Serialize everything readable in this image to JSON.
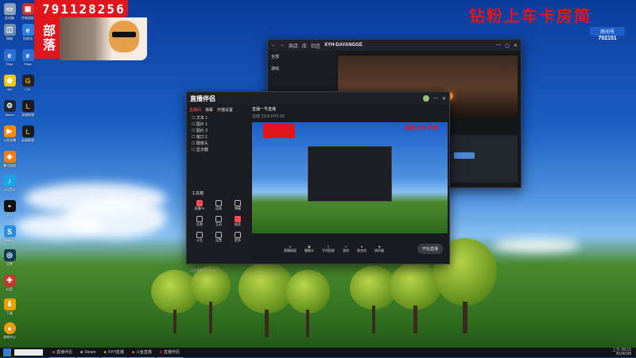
{
  "overlay": {
    "room_id": "791128256",
    "clan_label": "部落",
    "banner_text": "钻粉上车卡房简",
    "room_number_label": "房间号",
    "room_number": "702151",
    "brand_color": "#e0161c"
  },
  "desktop_icons": [
    "此电脑",
    "网络",
    "回收站",
    "控制面板",
    "Edge",
    "QQ",
    "360",
    "LOL",
    "Steam",
    "英雄联盟",
    "斗鱼直播",
    "腾讯游戏",
    "QQ音乐",
    "网易云",
    "抖音",
    "游戏中心",
    "设置",
    "下载"
  ],
  "browser": {
    "title": "XYH-DAYANGGE",
    "nav_items": [
      "商店",
      "库",
      "社区"
    ],
    "side_labels": [
      "全部",
      "游戏"
    ],
    "accent": "#4a88d8"
  },
  "obs": {
    "logo": "直播伴侣",
    "tabs": [
      "直播间",
      "弹幕",
      "开播设置"
    ],
    "scene_title": "直播一号直播",
    "stats": "在线 2315  FPS 60",
    "sources": [
      "文本 1",
      "图片 1",
      "图片 2",
      "窗口 1",
      "摄像头",
      "显示器"
    ],
    "tool_title": "工具箱",
    "tools": [
      "直播PK",
      "连线",
      "弹幕",
      "礼物",
      "互动",
      "抽奖",
      "公告",
      "设置",
      "更多"
    ],
    "bottom_actions": [
      "直播画面",
      "摄像头",
      "手机投屏",
      "游戏",
      "麦克风",
      "扬声器"
    ],
    "start_button": "开始直播",
    "status_text": "正在直播 00:36:12",
    "preview_banner": "钻粉上车卡房"
  },
  "taskbar": {
    "items": [
      "直播伴侣",
      "Steam",
      "XYH直播",
      "斗鱼直播",
      "直播伴侣"
    ],
    "clock": "上午 09:15",
    "date": "2024/3/8"
  }
}
